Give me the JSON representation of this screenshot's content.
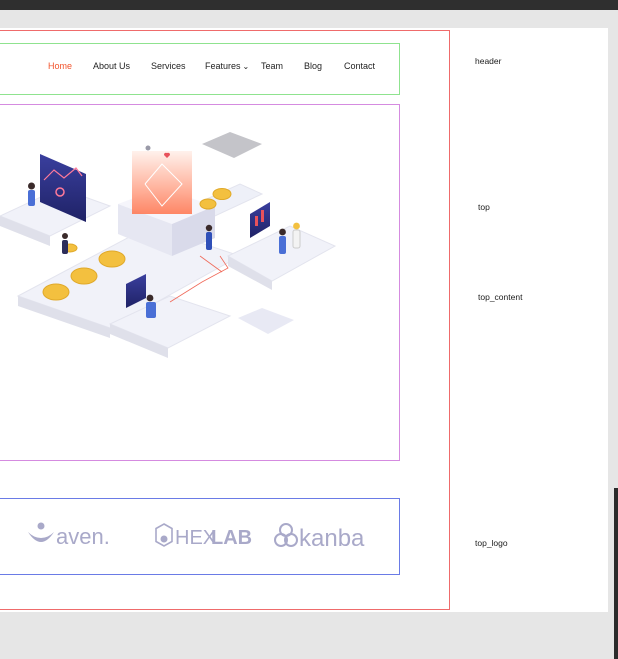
{
  "nav": {
    "items": [
      {
        "label": "Home"
      },
      {
        "label": "About Us"
      },
      {
        "label": "Services"
      },
      {
        "label": "Features"
      },
      {
        "label": "Team"
      },
      {
        "label": "Blog"
      },
      {
        "label": "Contact"
      }
    ],
    "active": "Home"
  },
  "sections": {
    "header": "header",
    "top": "top",
    "top_content": "top_content",
    "top_logo": "top_logo"
  },
  "logos": {
    "aven": "aven.",
    "hexlab_a": "HEX",
    "hexlab_b": "LAB",
    "kanba": "kanba"
  },
  "colors": {
    "active_nav": "#f2542d",
    "frame": "#ef6b6b",
    "header_outline": "#8fe38f",
    "top_outline": "#d58be0",
    "logo_outline": "#6a7be6",
    "logo_gray": "#a9a9c9"
  }
}
